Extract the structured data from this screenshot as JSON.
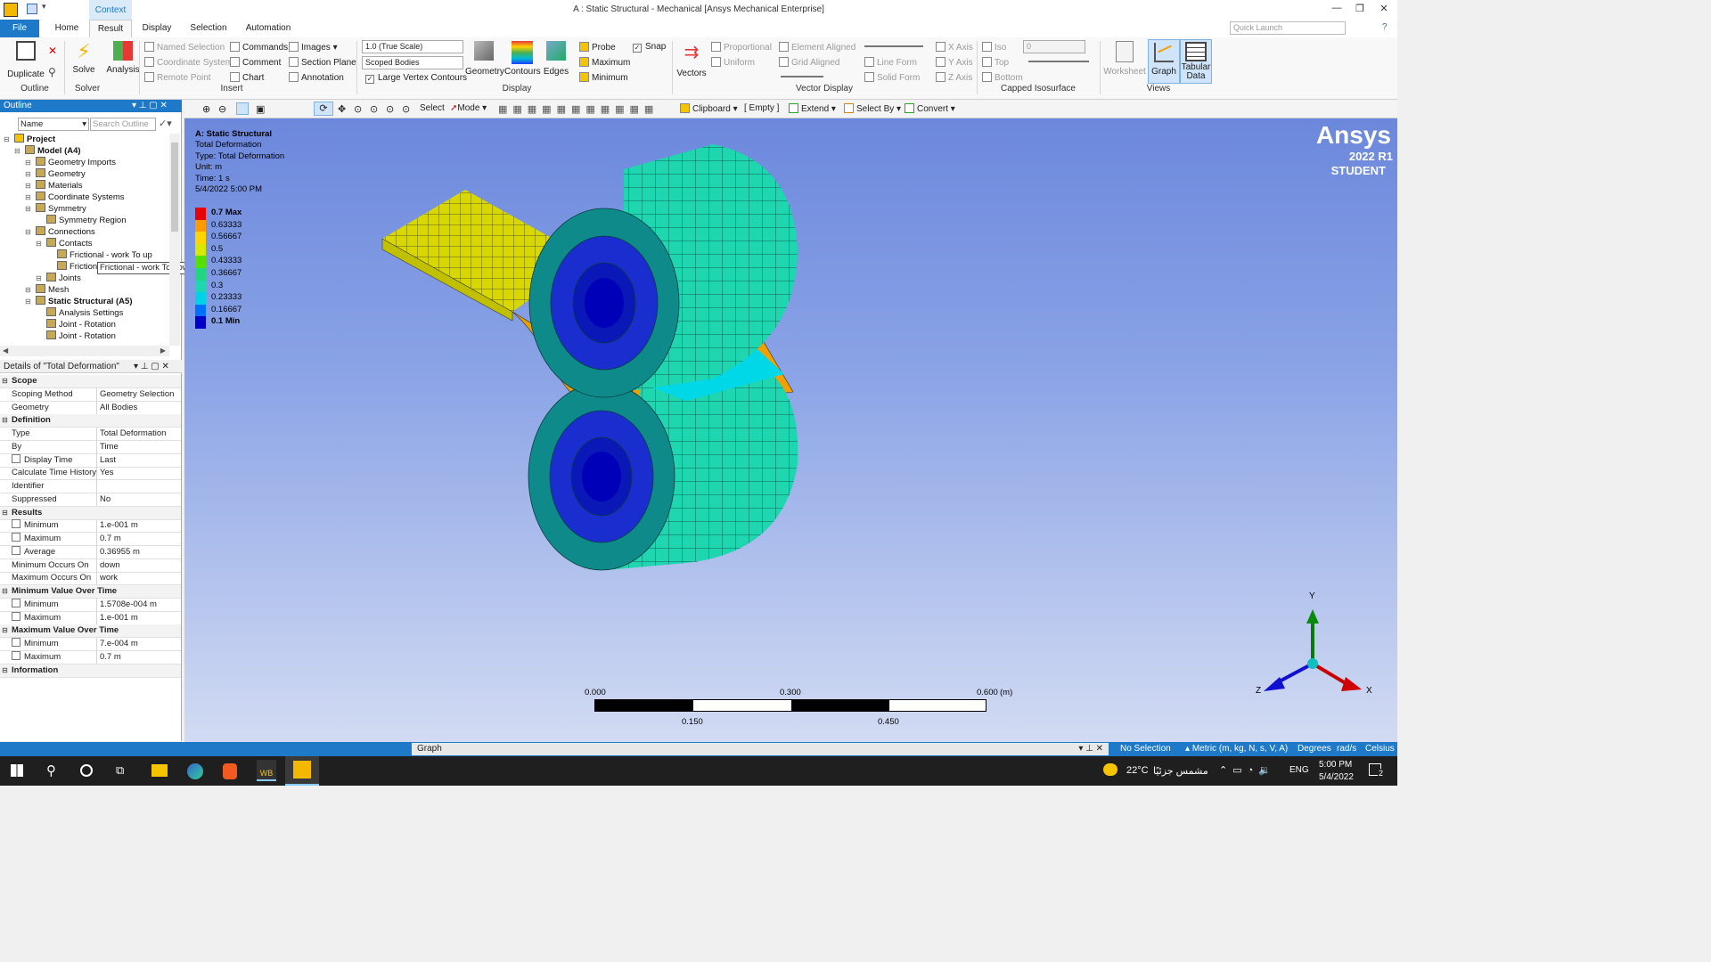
{
  "window": {
    "context_tab": "Context",
    "title": "A : Static Structural - Mechanical [Ansys Mechanical Enterprise]",
    "tabs": [
      "File",
      "Home",
      "Result",
      "Display",
      "Selection",
      "Automation"
    ],
    "quick_launch_placeholder": "Quick Launch"
  },
  "ribbon": {
    "duplicate": "Duplicate",
    "solve": "Solve",
    "analysis": "Analysis",
    "outline_group": "Outline",
    "solver_group": "Solver",
    "insert": {
      "named_selection": "Named Selection",
      "coordinate_system": "Coordinate System",
      "remote_point": "Remote Point",
      "commands": "Commands",
      "comment": "Comment",
      "chart": "Chart",
      "images": "Images",
      "section_plane": "Section Plane",
      "annotation": "Annotation",
      "group": "Insert"
    },
    "display": {
      "scale_value": "1.0 (True Scale)",
      "scoped_bodies": "Scoped Bodies",
      "large_vertex_contours": "Large Vertex Contours",
      "geometry": "Geometry",
      "contours": "Contours",
      "edges": "Edges",
      "probe": "Probe",
      "maximum": "Maximum",
      "minimum": "Minimum",
      "snap": "Snap",
      "group": "Display"
    },
    "vector_display": {
      "vectors": "Vectors",
      "proportional": "Proportional",
      "uniform": "Uniform",
      "element_aligned": "Element Aligned",
      "grid_aligned": "Grid Aligned",
      "line_form": "Line Form",
      "solid_form": "Solid Form",
      "x_axis": "X Axis",
      "y_axis": "Y Axis",
      "z_axis": "Z Axis",
      "group": "Vector Display"
    },
    "capped": {
      "iso": "Iso",
      "top": "Top",
      "bottom": "Bottom",
      "value": "0",
      "group": "Capped Isosurface"
    },
    "views": {
      "worksheet": "Worksheet",
      "graph": "Graph",
      "tabular_data_1": "Tabular",
      "tabular_data_2": "Data",
      "group": "Views"
    }
  },
  "toolbar2": {
    "select": "Select",
    "mode": "Mode",
    "clipboard": "Clipboard",
    "empty": "[ Empty ]",
    "extend": "Extend",
    "select_by": "Select By",
    "convert": "Convert"
  },
  "outline": {
    "title": "Outline",
    "name_filter": "Name",
    "search_placeholder": "Search Outline",
    "tree": [
      {
        "label": "Project",
        "depth": 0,
        "bold": true
      },
      {
        "label": "Model (A4)",
        "depth": 1,
        "bold": true
      },
      {
        "label": "Geometry Imports",
        "depth": 2
      },
      {
        "label": "Geometry",
        "depth": 2
      },
      {
        "label": "Materials",
        "depth": 2
      },
      {
        "label": "Coordinate Systems",
        "depth": 2
      },
      {
        "label": "Symmetry",
        "depth": 2
      },
      {
        "label": "Symmetry Region",
        "depth": 3
      },
      {
        "label": "Connections",
        "depth": 2
      },
      {
        "label": "Contacts",
        "depth": 3
      },
      {
        "label": "Frictional - work To up",
        "depth": 4
      },
      {
        "label": "Frictional - work To down",
        "depth": 4
      },
      {
        "label": "Joints",
        "depth": 3
      },
      {
        "label": "Mesh",
        "depth": 2
      },
      {
        "label": "Static Structural (A5)",
        "depth": 2,
        "bold": true
      },
      {
        "label": "Analysis Settings",
        "depth": 3
      },
      {
        "label": "Joint - Rotation",
        "depth": 3
      },
      {
        "label": "Joint - Rotation",
        "depth": 3
      }
    ],
    "tooltip": "Frictional - work To down"
  },
  "details": {
    "title": "Details of \"Total Deformation\"",
    "rows": [
      {
        "section": "Scope"
      },
      {
        "k": "Scoping Method",
        "v": "Geometry Selection"
      },
      {
        "k": "Geometry",
        "v": "All Bodies"
      },
      {
        "section": "Definition"
      },
      {
        "k": "Type",
        "v": "Total Deformation"
      },
      {
        "k": "By",
        "v": "Time"
      },
      {
        "k": "Display Time",
        "v": "Last",
        "check": true
      },
      {
        "k": "Calculate Time History",
        "v": "Yes"
      },
      {
        "k": "Identifier",
        "v": ""
      },
      {
        "k": "Suppressed",
        "v": "No"
      },
      {
        "section": "Results"
      },
      {
        "k": "Minimum",
        "v": "1.e-001 m",
        "check": true
      },
      {
        "k": "Maximum",
        "v": "0.7 m",
        "check": true
      },
      {
        "k": "Average",
        "v": "0.36955 m",
        "check": true
      },
      {
        "k": "Minimum Occurs On",
        "v": "down"
      },
      {
        "k": "Maximum Occurs On",
        "v": "work"
      },
      {
        "section": "Minimum Value Over Time"
      },
      {
        "k": "Minimum",
        "v": "1.5708e-004 m",
        "check": true
      },
      {
        "k": "Maximum",
        "v": "1.e-001 m",
        "check": true
      },
      {
        "section": "Maximum Value Over Time"
      },
      {
        "k": "Minimum",
        "v": "7.e-004 m",
        "check": true
      },
      {
        "k": "Maximum",
        "v": "0.7 m",
        "check": true
      },
      {
        "section": "Information"
      }
    ]
  },
  "viewport": {
    "info": [
      "A: Static Structural",
      "Total Deformation",
      "Type: Total Deformation",
      "Unit: m",
      "Time: 1 s",
      "5/4/2022 5:00 PM"
    ],
    "legend": [
      {
        "label": "0.7 Max",
        "color": "#e60000"
      },
      {
        "label": "0.63333",
        "color": "#ff9a00"
      },
      {
        "label": "0.56667",
        "color": "#ffd400"
      },
      {
        "label": "0.5",
        "color": "#d8e800"
      },
      {
        "label": "0.43333",
        "color": "#55e000"
      },
      {
        "label": "0.36667",
        "color": "#22d680"
      },
      {
        "label": "0.3",
        "color": "#1ed6b0"
      },
      {
        "label": "0.23333",
        "color": "#00d2e8"
      },
      {
        "label": "0.16667",
        "color": "#0070ff"
      },
      {
        "label": "0.1 Min",
        "color": "#0000c8"
      }
    ],
    "logo": {
      "brand": "Ansys",
      "release": "2022 R1",
      "edition": "STUDENT"
    },
    "scale": {
      "top": [
        "0.000",
        "0.300",
        "0.600"
      ],
      "unit": "(m)",
      "bottom": [
        "0.150",
        "0.450"
      ]
    },
    "axes": {
      "x": "X",
      "y": "Y",
      "z": "Z"
    }
  },
  "statusbar": {
    "graph": "Graph",
    "selection": "No Selection",
    "units": "Metric (m, kg, N, s, V, A)",
    "angle": "Degrees",
    "rot": "rad/s",
    "temp": "Celsius"
  },
  "taskbar": {
    "weather": "22°C",
    "weather_text": "مشمس جزئيًا",
    "lang": "ENG",
    "time": "5:00 PM",
    "date": "5/4/2022",
    "notifications": "2"
  },
  "colors": {
    "accent": "#1e79c8",
    "roller": "#1ed6b0",
    "plate": "#d8d800",
    "contact": "#f0a000"
  }
}
